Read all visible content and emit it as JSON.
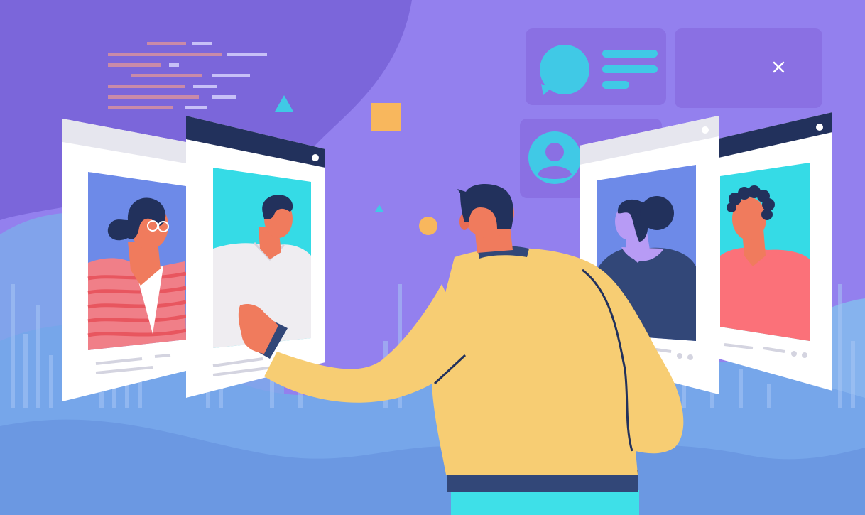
{
  "scene": {
    "description_text": "",
    "colors": {
      "background": "#8f7cec",
      "background_dark": "#7a64d9",
      "wave_blue": "#6fa0e6",
      "wave_light": "#8ec3f0",
      "card_bg": "#ffffff",
      "card_header_dark": "#2b3a66",
      "card_header_light": "#e6e6ee",
      "photo_blue": "#6d8ae8",
      "photo_cyan": "#35dbe6",
      "man_shirt": "#f7cd73",
      "man_hair": "#22315c",
      "man_pants": "#3ee0e8",
      "accent_cyan": "#40c9e6",
      "accent_orange": "#f8b75d",
      "skin_orange": "#f07b5d",
      "stripe_red": "#e8565f"
    },
    "icons": [
      "close-icon",
      "chat-bubble-icon",
      "user-avatar-icon",
      "triangle-shape",
      "square-shape",
      "circle-shape"
    ],
    "profile_cards": [
      {
        "name": "profile-card-woman-glasses"
      },
      {
        "name": "profile-card-man-white-sweater"
      },
      {
        "name": "profile-card-woman-bun"
      },
      {
        "name": "profile-card-man-curly-hair"
      }
    ]
  }
}
